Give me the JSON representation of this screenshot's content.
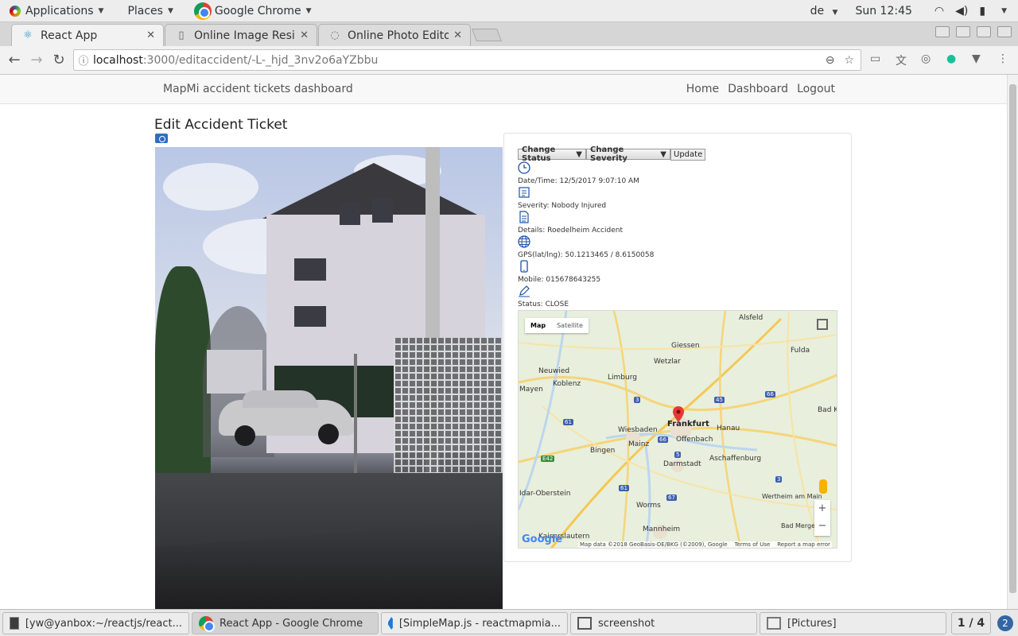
{
  "topbar": {
    "applications": "Applications",
    "places": "Places",
    "active_app": "Google Chrome",
    "keyboard_layout": "de",
    "clock": "Sun 12:45"
  },
  "browser": {
    "tabs": [
      {
        "title": "React App",
        "icon": "react-icon"
      },
      {
        "title": "Online Image Resize",
        "icon": "page-icon"
      },
      {
        "title": "Online Photo Editor",
        "icon": "loading-icon"
      }
    ],
    "url_host": "localhost",
    "url_path": ":3000/editaccident/-L-_hjd_3nv2o6aYZbbu"
  },
  "app": {
    "brand": "MapMi accident tickets dashboard",
    "nav": [
      "Home",
      "Dashboard",
      "Logout"
    ],
    "title": "Edit Accident Ticket"
  },
  "ticket": {
    "status_select": "Change Status",
    "severity_select": "Change Severity",
    "update_button": "Update",
    "datetime": "Date/Time: 12/5/2017 9:07:10 AM",
    "severity": "Severity: Nobody Injured",
    "details": "Details: Roedelheim Accident",
    "gps": "GPS(lat/lng): 50.1213465 / 8.6150058",
    "mobile": "Mobile: 015678643255",
    "status": "Status: CLOSE"
  },
  "map": {
    "map_button": "Map",
    "satellite_button": "Satellite",
    "cities": [
      "Alsfeld",
      "Giessen",
      "Fulda",
      "Neuwied",
      "Wetzlar",
      "Limburg",
      "Koblenz",
      "Mayen",
      "Frankfurt",
      "Hanau",
      "Wiesbaden",
      "Offenbach",
      "Mainz",
      "Bingen",
      "Darmstadt",
      "Aschaffenburg",
      "Bad Kis",
      "Idar-Oberstein",
      "Worms",
      "Wertheim am Main",
      "Bad Mergenthe",
      "Mannheim",
      "Kaiserslautern"
    ],
    "google": "Google",
    "attribution": "Map data ©2018 GeoBasis-DE/BKG (©2009), Google",
    "terms": "Terms of Use",
    "report": "Report a map error"
  },
  "taskbar": {
    "tasks": [
      "[yw@yanbox:~/reactjs/react...",
      "React App - Google Chrome",
      "[SimpleMap.js - reactmapmia...",
      "screenshot",
      "[Pictures]"
    ],
    "workspace": "1 / 4",
    "notifications": "2"
  }
}
